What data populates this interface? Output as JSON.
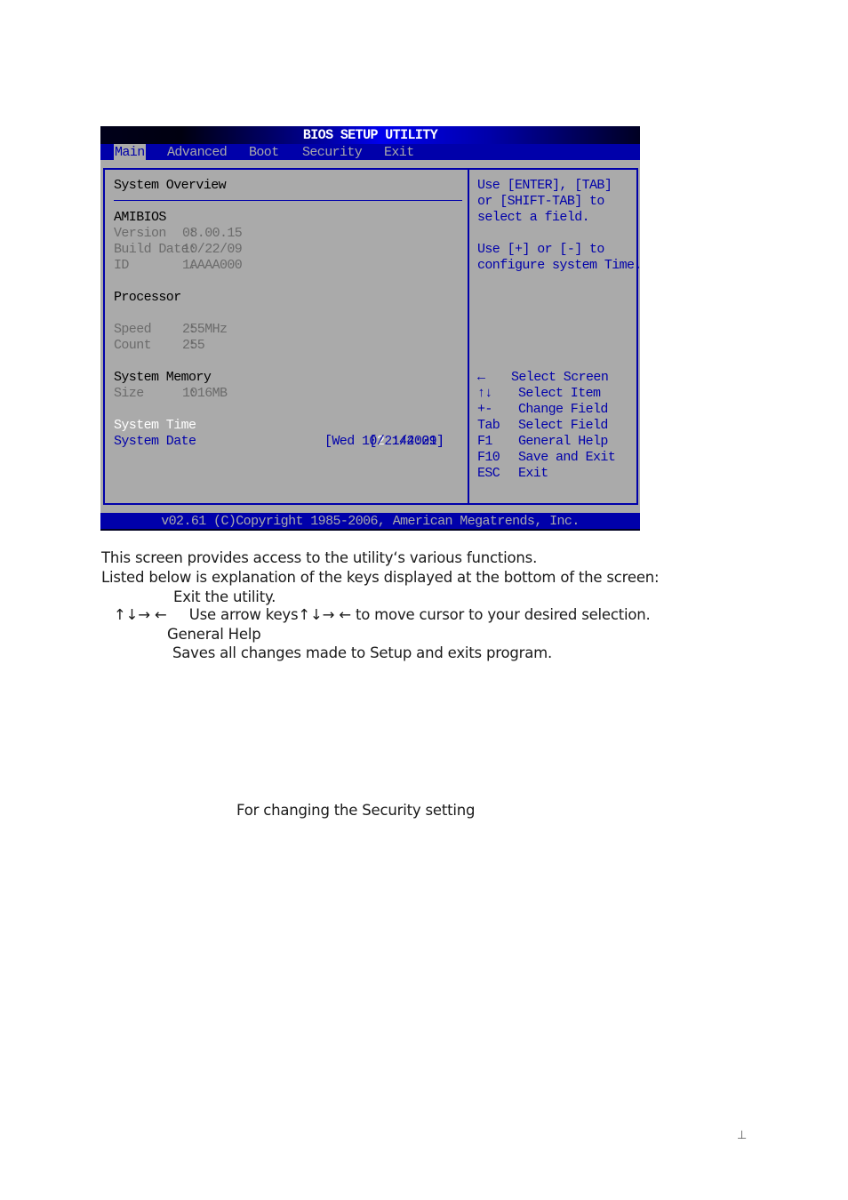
{
  "bios": {
    "title": "BIOS SETUP UTILITY",
    "menu": [
      {
        "label": "Main",
        "active": true
      },
      {
        "label": "Advanced",
        "active": false
      },
      {
        "label": "Boot",
        "active": false
      },
      {
        "label": "Security",
        "active": false
      },
      {
        "label": "Exit",
        "active": false
      }
    ],
    "overview_heading": "System Overview",
    "amibios": {
      "heading": "AMIBIOS",
      "version_label": "Version   :",
      "version_value": "08.00.15",
      "build_date_label": "Build Date:",
      "build_date_value": "10/22/09",
      "id_label": "ID        :",
      "id_value": "1AAAA000"
    },
    "processor": {
      "heading": "Processor",
      "speed_label": "Speed     :",
      "speed_value": "255MHz",
      "count_label": "Count     :",
      "count_value": "255"
    },
    "memory": {
      "heading": "System Memory",
      "size_label": "Size      :",
      "size_value": "1016MB"
    },
    "system_time": {
      "label": "System Time",
      "value_open": "[",
      "value_highlight": "22",
      "value_rest": ":44:21]"
    },
    "system_date": {
      "label": "System Date",
      "value": "[Wed 10/21/2009]"
    },
    "help_text": [
      "Use [ENTER], [TAB]",
      "or [SHIFT-TAB] to",
      "select a field.",
      "",
      "Use [+] or [-] to",
      "configure system Time."
    ],
    "keys": [
      {
        "key": "←",
        "desc": "Select Screen"
      },
      {
        "key": "↑↓",
        "desc": "Select Item"
      },
      {
        "key": "+-",
        "desc": "Change Field"
      },
      {
        "key": "Tab",
        "desc": "Select Field"
      },
      {
        "key": "F1",
        "desc": "General Help"
      },
      {
        "key": "F10",
        "desc": "Save and Exit"
      },
      {
        "key": "ESC",
        "desc": "Exit"
      }
    ],
    "footer": "v02.61 (C)Copyright 1985-2006, American Megatrends, Inc."
  },
  "document": {
    "lines": [
      "This screen provides access to the utility‘s various functions.",
      "Listed below is explanation of the keys displayed at the bottom of the screen:",
      "Exit the utility.",
      "↑↓→ ←     Use arrow keys↑↓→ ← to move cursor to your desired selection.",
      "General Help",
      "Saves all changes made to Setup and exits program."
    ],
    "security_note": "For changing the Security setting",
    "page_mark": "⊥"
  }
}
